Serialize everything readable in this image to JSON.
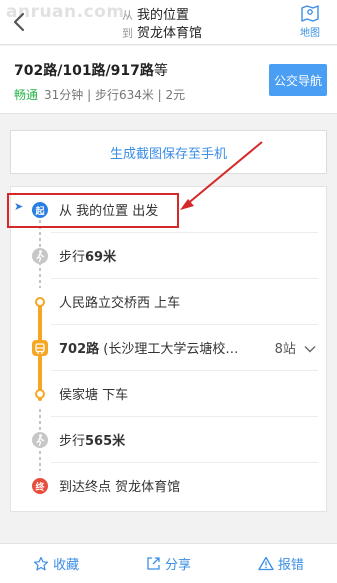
{
  "watermark": "anruan.com",
  "header": {
    "from_prefix": "从",
    "from_name": "我的位置",
    "to_prefix": "到",
    "to_name": "贺龙体育馆",
    "map_label": "地图"
  },
  "summary": {
    "title": "702路/101路/917路",
    "title_suffix": "等",
    "traffic": "畅通",
    "meta": "31分钟 | 步行634米 | 2元",
    "nav_button": "公交导航"
  },
  "screenshot_button": "生成截图保存至手机",
  "steps": {
    "start_badge": "起",
    "start_text": "从 我的位置 出发",
    "walk1_prefix": "步行",
    "walk1_value": "69米",
    "board_text": "人民路立交桥西 上车",
    "bus_line": "702路",
    "bus_direction": "(长沙理工大学云塘校…",
    "bus_stations": "8站",
    "alight_text": "侯家塘 下车",
    "walk2_prefix": "步行",
    "walk2_value": "565米",
    "end_badge": "终",
    "end_text": "到达终点 贺龙体育馆"
  },
  "bottom_bar": {
    "favorite": "收藏",
    "share": "分享",
    "report": "报错"
  },
  "colors": {
    "accent": "#3a8ee6",
    "bus_line": "#f5a623",
    "traffic_green": "#28b34b",
    "highlight_red": "#d62828"
  }
}
